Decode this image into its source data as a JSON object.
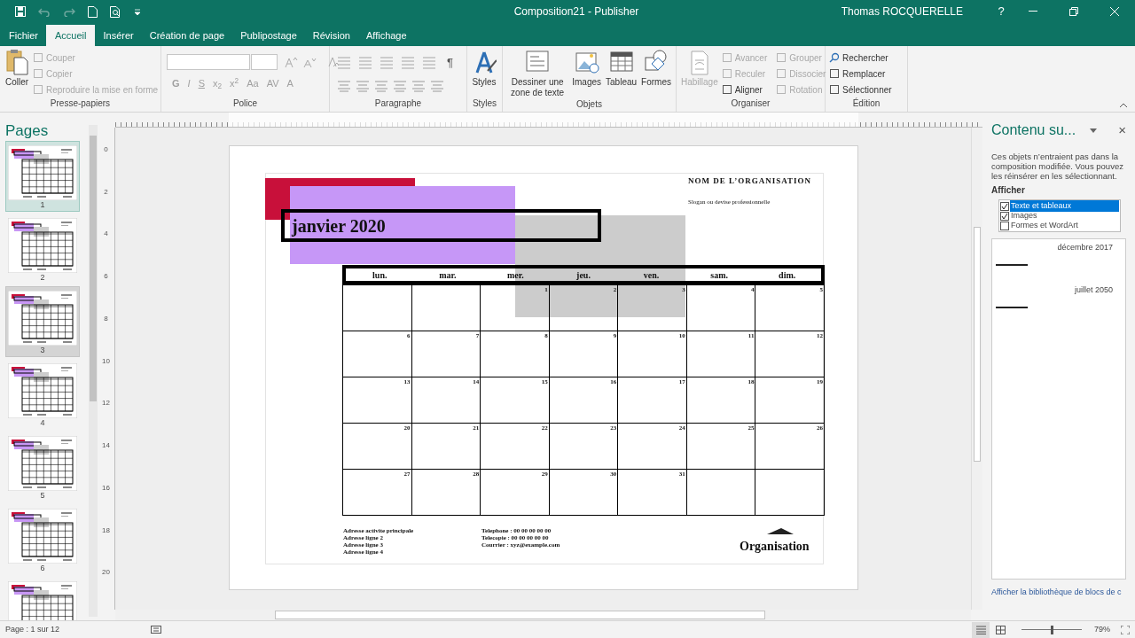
{
  "window": {
    "title": "Composition21  -  Publisher",
    "user": "Thomas ROCQUERELLE",
    "help": "?"
  },
  "tabs": [
    {
      "label": "Fichier",
      "selected": false
    },
    {
      "label": "Accueil",
      "selected": true
    },
    {
      "label": "Insérer",
      "selected": false
    },
    {
      "label": "Création de page",
      "selected": false
    },
    {
      "label": "Publipostage",
      "selected": false
    },
    {
      "label": "Révision",
      "selected": false
    },
    {
      "label": "Affichage",
      "selected": false
    }
  ],
  "ribbon": [
    {
      "kind": "buttons",
      "label": "Presse-papiers",
      "large": [
        {
          "label": "Coller",
          "disabled": false
        }
      ],
      "small": [
        {
          "label": "Couper",
          "disabled": true
        },
        {
          "label": "Copier",
          "disabled": true
        },
        {
          "label": "Reproduire la mise en forme",
          "disabled": true
        }
      ]
    },
    {
      "kind": "font",
      "label": "Police",
      "format_buttons": [
        "G",
        "I",
        "S",
        "x$_{2}$",
        "x$^{2}$",
        "Aa",
        "AV",
        "A"
      ]
    },
    {
      "kind": "paragraph",
      "label": "Paragraphe",
      "pilcrow": "¶"
    },
    {
      "kind": "buttons",
      "label": "Styles",
      "large": [
        {
          "label": "Styles",
          "disabled": false
        }
      ]
    },
    {
      "kind": "buttons",
      "label": "Objets",
      "large": [
        {
          "label": "Dessiner une zone de texte",
          "disabled": false
        },
        {
          "label": "Images",
          "disabled": false
        },
        {
          "label": "Tableau",
          "disabled": false
        },
        {
          "label": "Formes",
          "disabled": false
        }
      ]
    },
    {
      "kind": "buttons",
      "label": "Organiser",
      "large": [
        {
          "label": "Habillage",
          "disabled": true
        }
      ],
      "small": [
        {
          "label": "Avancer",
          "disabled": true
        },
        {
          "label": "Reculer",
          "disabled": true
        },
        {
          "label": "Aligner",
          "disabled": false
        },
        {
          "label": "Grouper",
          "disabled": true
        },
        {
          "label": "Dissocier",
          "disabled": true
        },
        {
          "label": "Rotation",
          "disabled": true
        }
      ]
    },
    {
      "kind": "buttons",
      "label": "Édition",
      "small": [
        {
          "label": "Rechercher",
          "disabled": false
        },
        {
          "label": "Remplacer",
          "disabled": false
        },
        {
          "label": "Sélectionner",
          "disabled": false
        }
      ]
    }
  ],
  "pages_pane": {
    "title": "Pages",
    "thumbnails": [
      {
        "number": "1",
        "selected": true,
        "hovered": false
      },
      {
        "number": "2",
        "selected": false,
        "hovered": false
      },
      {
        "number": "3",
        "selected": false,
        "hovered": true
      },
      {
        "number": "4",
        "selected": false,
        "hovered": false
      },
      {
        "number": "5",
        "selected": false,
        "hovered": false
      },
      {
        "number": "6",
        "selected": false,
        "hovered": false
      },
      {
        "selected": false,
        "hovered": false
      }
    ]
  },
  "vertical_ruler": [
    "0",
    "2",
    "4",
    "6",
    "8",
    "10",
    "12",
    "14",
    "16",
    "18",
    "20"
  ],
  "document": {
    "organization": "NOM DE L’ORGANISATION",
    "slogan": "Slogan ou devise professionnelle",
    "month": "janvier 2020",
    "weekdays": [
      "lun.",
      "mar.",
      "mer.",
      "jeu.",
      "ven.",
      "sam.",
      "dim."
    ],
    "weeks": [
      [
        {
          "kind": "blank"
        },
        {
          "kind": "blank"
        },
        {
          "kind": "day",
          "day": "1"
        },
        {
          "kind": "day",
          "day": "2"
        },
        {
          "kind": "day",
          "day": "3"
        },
        {
          "kind": "day",
          "day": "4"
        },
        {
          "kind": "day",
          "day": "5"
        }
      ],
      [
        {
          "kind": "day",
          "day": "6"
        },
        {
          "kind": "day",
          "day": "7"
        },
        {
          "kind": "day",
          "day": "8"
        },
        {
          "kind": "day",
          "day": "9"
        },
        {
          "kind": "day",
          "day": "10"
        },
        {
          "kind": "day",
          "day": "11"
        },
        {
          "kind": "day",
          "day": "12"
        }
      ],
      [
        {
          "kind": "day",
          "day": "13"
        },
        {
          "kind": "day",
          "day": "14"
        },
        {
          "kind": "day",
          "day": "15"
        },
        {
          "kind": "day",
          "day": "16"
        },
        {
          "kind": "day",
          "day": "17"
        },
        {
          "kind": "day",
          "day": "18"
        },
        {
          "kind": "day",
          "day": "19"
        }
      ],
      [
        {
          "kind": "day",
          "day": "20"
        },
        {
          "kind": "day",
          "day": "21"
        },
        {
          "kind": "day",
          "day": "22"
        },
        {
          "kind": "day",
          "day": "23"
        },
        {
          "kind": "day",
          "day": "24"
        },
        {
          "kind": "day",
          "day": "25"
        },
        {
          "kind": "day",
          "day": "26"
        }
      ],
      [
        {
          "kind": "day",
          "day": "27"
        },
        {
          "kind": "day",
          "day": "28"
        },
        {
          "kind": "day",
          "day": "29"
        },
        {
          "kind": "day",
          "day": "30"
        },
        {
          "kind": "day",
          "day": "31"
        },
        {
          "kind": "blank"
        },
        {
          "kind": "blank"
        }
      ]
    ],
    "address": [
      "Adresse activite principale",
      "Adresse ligne 2",
      "Adresse ligne 3",
      "Adresse ligne 4"
    ],
    "contact": [
      "Telephone : 00 00 00 00 00",
      "Telecopie : 00 00 00 00 00",
      "Courrier : xyz@example.com"
    ],
    "logo": "Organisation"
  },
  "side_pane": {
    "title": "Contenu su...",
    "close": "×",
    "description": "Ces objets n’entraient pas dans la composition modifiée. Vous pouvez les réinsérer en les sélectionnant.",
    "filter_label": "Afficher",
    "filters": [
      {
        "label": "Texte et tableaux",
        "checked": true,
        "selected": true
      },
      {
        "label": "Images",
        "checked": true,
        "selected": false
      },
      {
        "label": "Formes et WordArt",
        "checked": false,
        "selected": false
      }
    ],
    "items": [
      {
        "label": "décembre 2017"
      },
      {
        "label": "juillet 2050"
      }
    ],
    "link": "Afficher la bibliothèque de blocs de c"
  },
  "status_bar": {
    "page": "Page : 1 sur 12",
    "zoom": "79%",
    "zoom_level": {
      "level": 0.5
    }
  }
}
